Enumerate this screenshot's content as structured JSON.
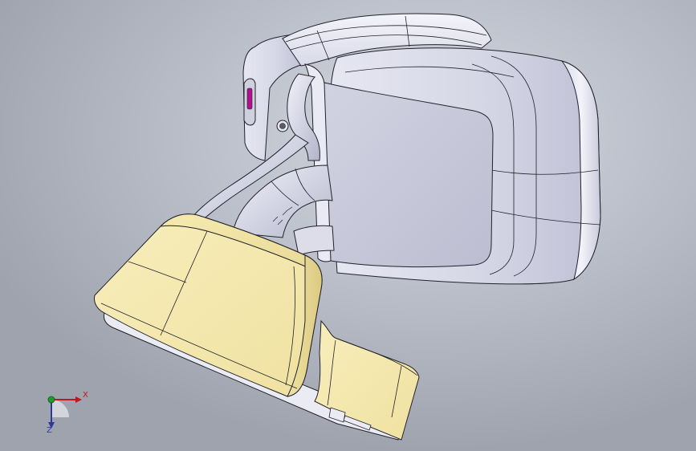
{
  "viewport": {
    "background_center": "#d4d8e0",
    "background_edge": "#9ea3ae"
  },
  "model": {
    "housing_color": "#d8d9e8",
    "cover_color": "#f2e6a8",
    "accent_color": "#b0108c"
  },
  "triad": {
    "x_label": "X",
    "z_label": "Z",
    "x_color": "#c01818",
    "y_color": "#1c9c2c",
    "z_color": "#2a3a9a"
  }
}
